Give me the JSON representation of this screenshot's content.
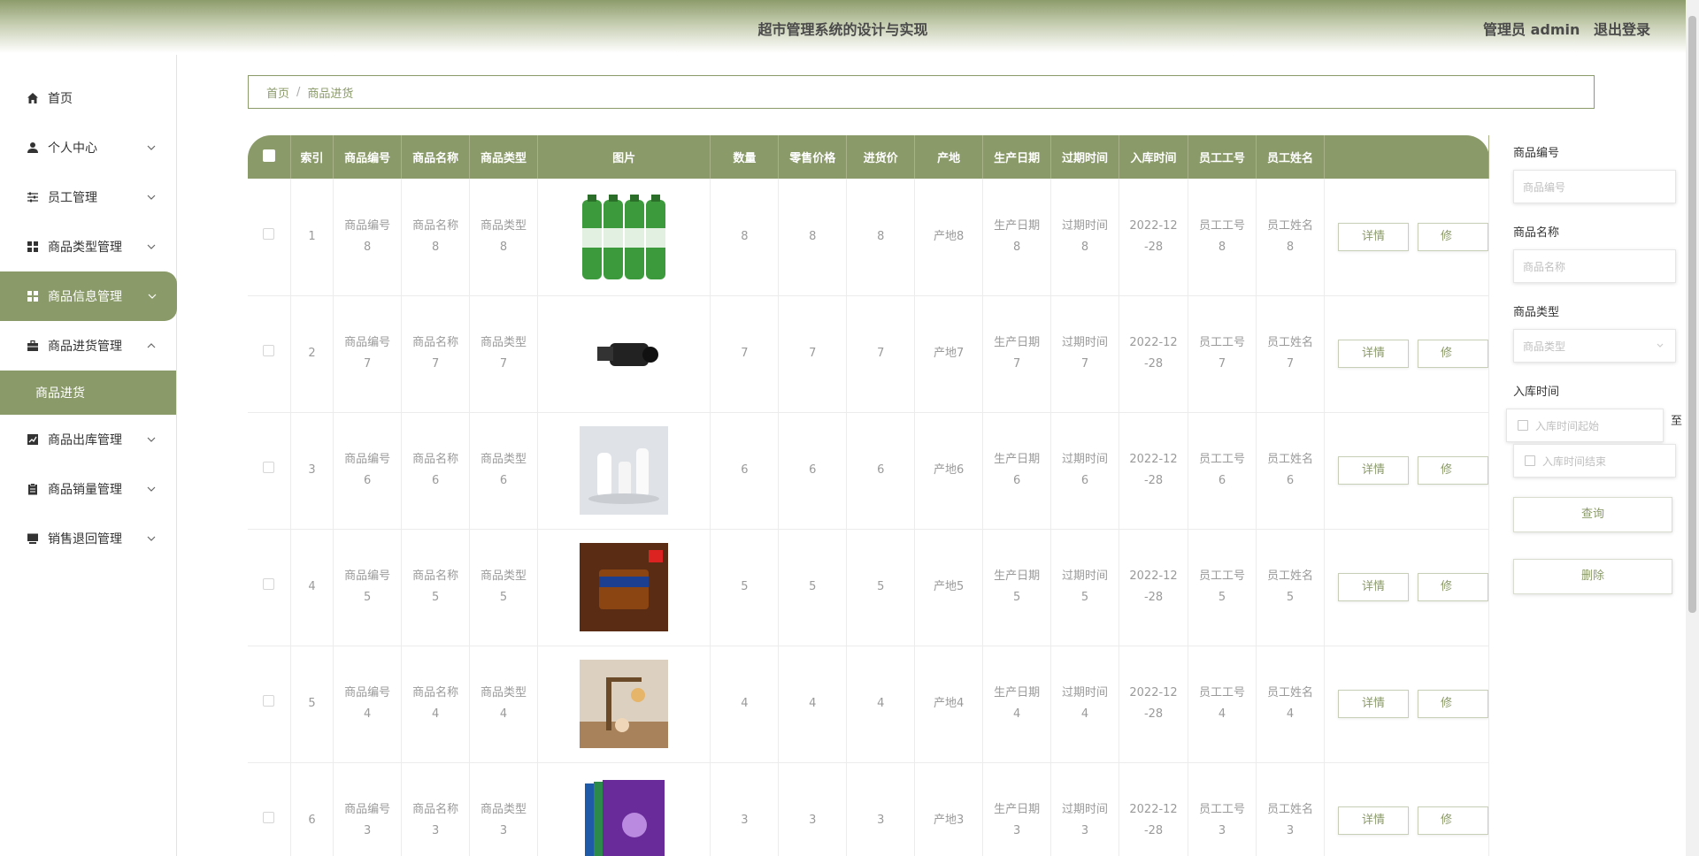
{
  "header": {
    "title": "超市管理系统的设计与实现",
    "role": "管理员 admin",
    "logout": "退出登录"
  },
  "sidebar": {
    "items": [
      {
        "label": "首页",
        "icon": "home-icon"
      },
      {
        "label": "个人中心",
        "icon": "user-icon"
      },
      {
        "label": "员工管理",
        "icon": "sliders-icon"
      },
      {
        "label": "商品类型管理",
        "icon": "grid-icon"
      },
      {
        "label": "商品信息管理",
        "icon": "grid-icon"
      },
      {
        "label": "商品进货管理",
        "icon": "briefcase-icon"
      },
      {
        "label": "商品出库管理",
        "icon": "chart-icon"
      },
      {
        "label": "商品销量管理",
        "icon": "clipboard-icon"
      },
      {
        "label": "销售退回管理",
        "icon": "monitor-icon"
      }
    ],
    "sub_item": "商品进货"
  },
  "breadcrumb": {
    "home": "首页",
    "sep": "/",
    "current": "商品进货"
  },
  "table": {
    "headers": [
      "索引",
      "商品编号",
      "商品名称",
      "商品类型",
      "图片",
      "数量",
      "零售价格",
      "进货价",
      "产地",
      "生产日期",
      "过期时间",
      "入库时间",
      "员工工号",
      "员工姓名"
    ],
    "rows": [
      {
        "idx": "1",
        "code": "商品编号8",
        "name": "商品名称8",
        "type": "商品类型8",
        "img": "aloe-drink-bottles",
        "qty": "8",
        "retail": "8",
        "cost": "8",
        "origin": "产地8",
        "mfg": "生产日期8",
        "exp": "过期时间8",
        "instock": "2022-12-28",
        "emp_id": "员工工号8",
        "emp_name": "员工姓名8"
      },
      {
        "idx": "2",
        "code": "商品编号7",
        "name": "商品名称7",
        "type": "商品类型7",
        "img": "camcorder",
        "qty": "7",
        "retail": "7",
        "cost": "7",
        "origin": "产地7",
        "mfg": "生产日期7",
        "exp": "过期时间7",
        "instock": "2022-12-28",
        "emp_id": "员工工号7",
        "emp_name": "员工姓名7"
      },
      {
        "idx": "3",
        "code": "商品编号6",
        "name": "商品名称6",
        "type": "商品类型6",
        "img": "appliances",
        "qty": "6",
        "retail": "6",
        "cost": "6",
        "origin": "产地6",
        "mfg": "生产日期6",
        "exp": "过期时间6",
        "instock": "2022-12-28",
        "emp_id": "员工工号6",
        "emp_name": "员工姓名6"
      },
      {
        "idx": "4",
        "code": "商品编号5",
        "name": "商品名称5",
        "type": "商品类型5",
        "img": "snickers-cup",
        "qty": "5",
        "retail": "5",
        "cost": "5",
        "origin": "产地5",
        "mfg": "生产日期5",
        "exp": "过期时间5",
        "instock": "2022-12-28",
        "emp_id": "员工工号5",
        "emp_name": "员工姓名5"
      },
      {
        "idx": "5",
        "code": "商品编号4",
        "name": "商品名称4",
        "type": "商品类型4",
        "img": "figurine-lamp",
        "qty": "4",
        "retail": "4",
        "cost": "4",
        "origin": "产地4",
        "mfg": "生产日期4",
        "exp": "过期时间4",
        "instock": "2022-12-28",
        "emp_id": "员工工号4",
        "emp_name": "员工姓名4"
      },
      {
        "idx": "6",
        "code": "商品编号3",
        "name": "商品名称3",
        "type": "商品类型3",
        "img": "book-set",
        "qty": "3",
        "retail": "3",
        "cost": "3",
        "origin": "产地3",
        "mfg": "生产日期3",
        "exp": "过期时间3",
        "instock": "2022-12-28",
        "emp_id": "员工工号3",
        "emp_name": "员工姓名3"
      }
    ],
    "detail_btn": "详情",
    "edit_btn_partial": "修"
  },
  "search": {
    "code_label": "商品编号",
    "code_placeholder": "商品编号",
    "name_label": "商品名称",
    "name_placeholder": "商品名称",
    "type_label": "商品类型",
    "type_placeholder": "商品类型",
    "time_label": "入库时间",
    "time_start": "入库时间起始",
    "time_end": "入库时间结束",
    "to": "至",
    "query": "查询",
    "delete": "删除"
  },
  "colors": {
    "accent": "#8a9a68"
  }
}
